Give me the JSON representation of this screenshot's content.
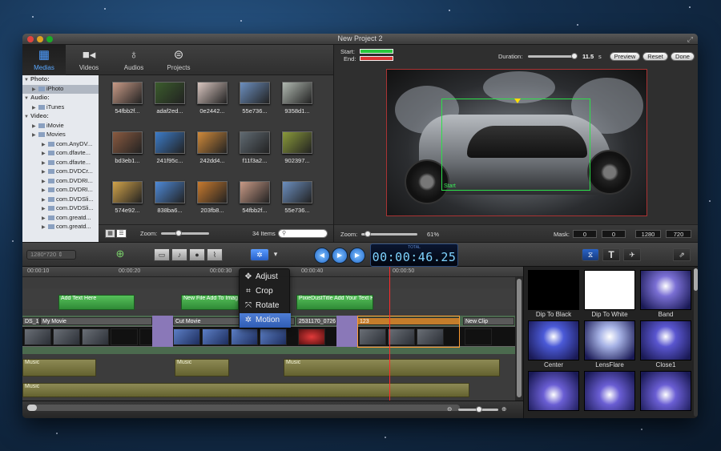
{
  "window": {
    "title": "New Project 2"
  },
  "tabs": [
    {
      "label": "Medias",
      "icon": "film-icon"
    },
    {
      "label": "Videos",
      "icon": "camera-icon"
    },
    {
      "label": "Audios",
      "icon": "microphone-icon"
    },
    {
      "label": "Projects",
      "icon": "reel-icon"
    }
  ],
  "tree": [
    {
      "label": "Photo:",
      "type": "head"
    },
    {
      "label": "iPhoto",
      "type": "child",
      "selected": true
    },
    {
      "label": "Audio:",
      "type": "head"
    },
    {
      "label": "iTunes",
      "type": "child"
    },
    {
      "label": "Video:",
      "type": "head"
    },
    {
      "label": "iMovie",
      "type": "child"
    },
    {
      "label": "Movies",
      "type": "child"
    },
    {
      "label": "com.AnyDV...",
      "type": "sub"
    },
    {
      "label": "com.dfavte...",
      "type": "sub"
    },
    {
      "label": "com.dfavte...",
      "type": "sub"
    },
    {
      "label": "com.DVDCr...",
      "type": "sub"
    },
    {
      "label": "com.DVDRI...",
      "type": "sub"
    },
    {
      "label": "com.DVDRI...",
      "type": "sub"
    },
    {
      "label": "com.DVDSli...",
      "type": "sub"
    },
    {
      "label": "com.DVDSli...",
      "type": "sub"
    },
    {
      "label": "com.greatd...",
      "type": "sub"
    },
    {
      "label": "com.greatd...",
      "type": "sub"
    }
  ],
  "media_grid": [
    {
      "caption": "54fbb2f...",
      "color": "#c89a86"
    },
    {
      "caption": "adaf2ed...",
      "color": "#3b5c2c"
    },
    {
      "caption": "0e2442...",
      "color": "#d9c6c0"
    },
    {
      "caption": "55e736...",
      "color": "#6c8fbf"
    },
    {
      "caption": "9358d1...",
      "color": "#b0b8b0"
    },
    {
      "caption": "bd3eb1...",
      "color": "#8a5a40"
    },
    {
      "caption": "241f95c...",
      "color": "#3c7cc9"
    },
    {
      "caption": "242dd4...",
      "color": "#d08a3a"
    },
    {
      "caption": "f11f3a2...",
      "color": "#606a72"
    },
    {
      "caption": "902397...",
      "color": "#8a9a3a"
    },
    {
      "caption": "574e92...",
      "color": "#d1a34a"
    },
    {
      "caption": "838ba6...",
      "color": "#4e8ad8"
    },
    {
      "caption": "203fb8...",
      "color": "#c87a2e"
    },
    {
      "caption": "54fbb2f...",
      "color": "#c89a86"
    },
    {
      "caption": "55e736...",
      "color": "#6c8fbf"
    }
  ],
  "grid_footer": {
    "zoom_label": "Zoom:",
    "items_count": "34 Items",
    "search_placeholder": ""
  },
  "preview": {
    "start_label": "Start:",
    "end_label": "End:",
    "duration_label": "Duration:",
    "duration_value": "11.5",
    "duration_unit": "s",
    "preview_button": "Preview",
    "reset_button": "Reset",
    "done_button": "Done",
    "pip_label": "Start",
    "zoom_label": "Zoom:",
    "zoom_value": "61%",
    "mask_label": "Mask:",
    "mask_x": "0",
    "mask_y": "0",
    "width": "1280",
    "height": "720"
  },
  "toolbar": {
    "resolution": "1280*720",
    "timecode_label": "TOTAL",
    "timecode": "00:00:46.25"
  },
  "ruler": [
    "00:00:10",
    "00:00:20",
    "00:00:30",
    "00:00:40",
    "00:00:50"
  ],
  "timeline": {
    "title_clips": [
      {
        "label": "Add Text Here"
      },
      {
        "label": "New File Add To Image"
      },
      {
        "label": "PixieDustTitle Add Your Text H"
      }
    ],
    "video_clips": [
      {
        "label": "DS_1"
      },
      {
        "label": "My Movie"
      },
      {
        "label": "Cut Movie"
      },
      {
        "label": "2531170_0726"
      },
      {
        "label": "123"
      },
      {
        "label": "New Clip"
      }
    ],
    "music_clips": [
      {
        "label": "Music"
      },
      {
        "label": "Music"
      },
      {
        "label": "Music"
      },
      {
        "label": "Music"
      }
    ]
  },
  "menu": [
    {
      "label": "Adjust",
      "icon": "move-icon"
    },
    {
      "label": "Crop",
      "icon": "crop-icon"
    },
    {
      "label": "Rotate",
      "icon": "rotate-icon"
    },
    {
      "label": "Motion",
      "icon": "motion-icon",
      "highlighted": true
    }
  ],
  "transitions": [
    {
      "label": "Dip To Black",
      "color": "#000000"
    },
    {
      "label": "Dip To White",
      "color": "#ffffff"
    },
    {
      "label": "Band",
      "color": "#7a6fd4"
    },
    {
      "label": "Center",
      "color": "#4b5ad8"
    },
    {
      "label": "LensFlare",
      "color": "#a7b3e6"
    },
    {
      "label": "Close1",
      "color": "#5a56d0"
    }
  ]
}
